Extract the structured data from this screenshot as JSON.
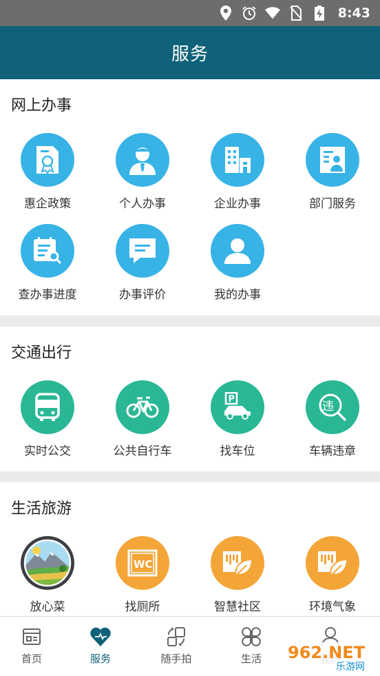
{
  "status": {
    "time": "8:43"
  },
  "header": {
    "title": "服务"
  },
  "sections": [
    {
      "title": "网上办事",
      "items": [
        {
          "label": "惠企政策",
          "icon": "certificate-icon"
        },
        {
          "label": "个人办事",
          "icon": "person-icon"
        },
        {
          "label": "企业办事",
          "icon": "building-icon"
        },
        {
          "label": "部门服务",
          "icon": "department-card-icon"
        },
        {
          "label": "查办事进度",
          "icon": "progress-search-icon"
        },
        {
          "label": "办事评价",
          "icon": "comment-icon"
        },
        {
          "label": "我的办事",
          "icon": "user-icon"
        }
      ]
    },
    {
      "title": "交通出行",
      "items": [
        {
          "label": "实时公交",
          "icon": "bus-icon"
        },
        {
          "label": "公共自行车",
          "icon": "bicycle-icon"
        },
        {
          "label": "找车位",
          "icon": "parking-icon"
        },
        {
          "label": "车辆违章",
          "icon": "violation-search-icon"
        }
      ]
    },
    {
      "title": "生活旅游",
      "items": [
        {
          "label": "放心菜",
          "icon": "landscape-icon"
        },
        {
          "label": "找厕所",
          "icon": "wc-icon"
        },
        {
          "label": "智慧社区",
          "icon": "leaf-card-icon"
        },
        {
          "label": "环境气象",
          "icon": "leaf-card-icon"
        }
      ]
    }
  ],
  "tabs": [
    {
      "label": "首页",
      "icon": "home-icon"
    },
    {
      "label": "服务",
      "icon": "heart-icon",
      "active": true
    },
    {
      "label": "随手拍",
      "icon": "snap-icon"
    },
    {
      "label": "生活",
      "icon": "clover-icon"
    },
    {
      "label": "我的",
      "icon": "profile-icon"
    }
  ],
  "watermark": {
    "text": "962.NET",
    "sub": "乐游网"
  },
  "colors": {
    "header": "#0f6279",
    "blue": "#37b3e6",
    "green": "#2ab796",
    "orange": "#f4a537"
  }
}
